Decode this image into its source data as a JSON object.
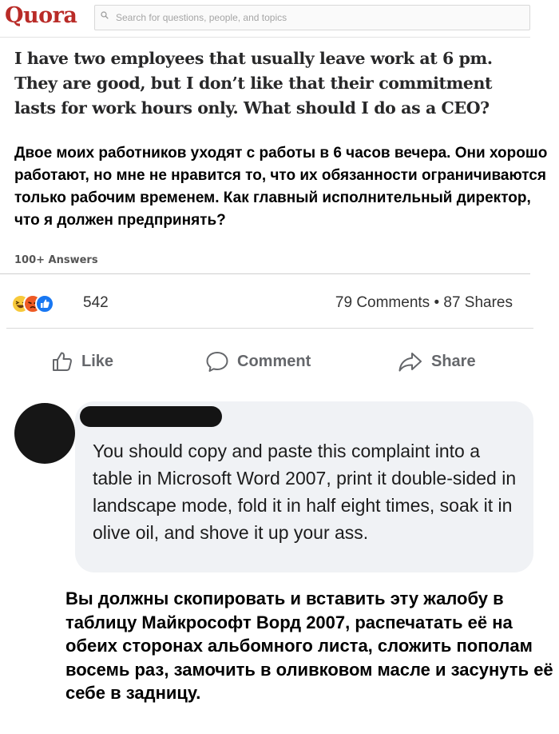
{
  "quora": {
    "logo": "Quora",
    "search_placeholder": "Search for questions, people, and topics",
    "question_title": "I have two employees that usually leave work at 6 pm. They are good, but I don’t like that their commitment lasts for work hours only. What should I do as a CEO?",
    "question_translation": "Двое моих работников уходят с работы в 6 часов вечера. Они хорошо работают, но мне не нравится то, что их обязанности ограничиваются только рабочим временем. Как главный исполнительный директор, что я должен предпринять?",
    "answers_count": "100+ Answers"
  },
  "facebook": {
    "reactions": {
      "icons": [
        "haha-reaction-icon",
        "angry-reaction-icon",
        "like-reaction-icon"
      ],
      "count": "542"
    },
    "comments_shares": "79 Comments • 87 Shares",
    "actions": {
      "like": "Like",
      "comment": "Comment",
      "share": "Share"
    },
    "comment": {
      "text": "You should copy and paste this complaint into a table in Microsoft Word 2007, print it double-sided in landscape mode, fold it in half eight times, soak it in olive oil, and shove it up your ass.",
      "translation": "Вы должны скопировать и вставить эту жалобу в таблицу Майкрософт Ворд 2007, распечатать её на обеих сторонах альбомного листа, сложить пополам восемь раз, замочить в оливковом масле и засунуть её себе в задницу."
    }
  },
  "colors": {
    "quora_brand": "#b92b27",
    "facebook_blue": "#1877f2",
    "bubble_bg": "#f0f2f5"
  }
}
